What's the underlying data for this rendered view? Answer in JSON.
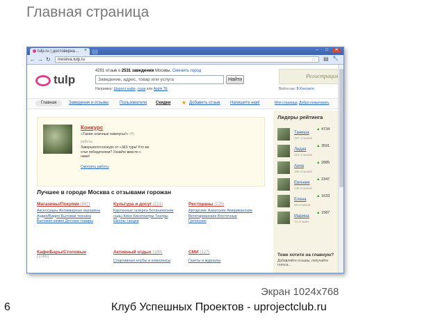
{
  "slide": {
    "title": "Главная страница",
    "caption": "Экран 1024x768",
    "number": "6",
    "footer": "Клуб Успешных Проектов - uprojectclub.ru"
  },
  "browser": {
    "tab_title": "tulp.ru | достоверна…",
    "tab_close": "×",
    "url": "moskva.tulp.ru",
    "back": "←",
    "forward": "→",
    "reload": "↻",
    "star": "☆",
    "minimize": "–",
    "maximize": "□",
    "close": "✕",
    "page_icon": "▤",
    "wrench_icon": "🔧"
  },
  "header": {
    "logo": "tulp",
    "stats_count": "4291",
    "stats_mid": "отзыв о",
    "stats_places": "2531 заведении",
    "stats_city": "Москвы.",
    "change_city": "Сменить город",
    "search_placeholder": "Заведение, адрес, товар или услуга",
    "search_button": "Найти",
    "example_label": "Например:",
    "example_1": "Шарлот кафе",
    "example_2": "суши",
    "example_3": "Apple TE",
    "register": "Регистрация",
    "login_label": "Войти как:",
    "login_link": "В Контакте"
  },
  "nav": {
    "home": "Главная",
    "places": "Заведения и отзывы",
    "users": "Пользователи",
    "discounts": "Скидки",
    "star_icon": "★",
    "add_review": "Добавить отзыв",
    "write_us": "Напишите нам!",
    "right_1": "Моя страница",
    "right_2": "Добро пожаловать"
  },
  "contest": {
    "title": "Конкурс",
    "subtitle": "«Такие злачные кампусы!»",
    "subtitle_count": "(4)",
    "label": "работы",
    "text": "Завершился конкурс от «J&S туры! Кто же стал победителем? Узнайте вместе с нами!",
    "link": "Смотреть работы"
  },
  "best": {
    "heading": "Лучшее в городе Москва с отзывами горожан"
  },
  "categories": [
    {
      "title": "Магазины/Покупки",
      "count": "(947)",
      "links": "Аксессуары Антикварные магазины Аудио/Видео Бытовая техника Бытовая химия Детские товары"
    },
    {
      "title": "Культура и досуг",
      "count": "(221)",
      "links": "Картинные галереи Ботанические сады Кино Кинотеатры Театры Школы танцев"
    },
    {
      "title": "Рестораны",
      "count": "(225)",
      "links": "Авторские Азиатские Американские Вегетарианские Восточные Греческие"
    },
    {
      "title": "Кафе/Бары/Столовые",
      "count": "(1080)",
      "links": ""
    },
    {
      "title": "Активный отдых",
      "count": "(189)",
      "links": "Спортивные клубы и комплексы"
    },
    {
      "title": "СМИ",
      "count": "(127)",
      "links": "Газеты и журналы"
    }
  ],
  "sidebar": {
    "leaders_title": "Лидеры рейтинга",
    "leaders": [
      {
        "name": "Таниша",
        "sub": "287 отзывов",
        "score": "4734"
      },
      {
        "name": "Лидия",
        "sub": "213 отзывов",
        "score": "3591"
      },
      {
        "name": "Анна",
        "sub": "166 отзывов",
        "score": "2885"
      },
      {
        "name": "Евгения",
        "sub": "138 отзывов",
        "score": "2347"
      },
      {
        "name": "Елена",
        "sub": "98 отзывов",
        "score": "1633"
      },
      {
        "name": "Марина",
        "sub": "74 отзыва",
        "score": "1587"
      }
    ],
    "score_arrow": "▲",
    "want_title": "Тоже хотите на главную?",
    "want_text": "Добавляйте отзывы, получайте голоса..."
  },
  "colors": {
    "brand_pink": "#e0408a",
    "link_blue": "#2263b5",
    "category_red": "#c0392b",
    "browser_blue": "#4f79c4"
  }
}
